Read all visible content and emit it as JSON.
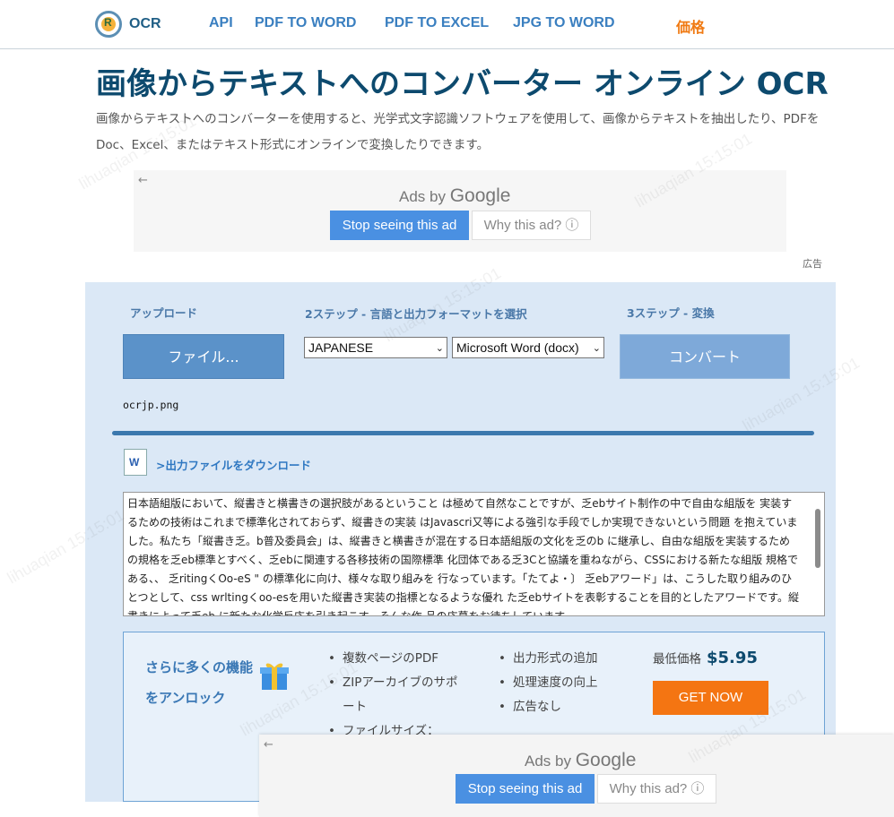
{
  "header": {
    "logo_text": "OCR",
    "nav": [
      {
        "label": "API"
      },
      {
        "label": "PDF TO WORD"
      },
      {
        "label": "PDF TO EXCEL"
      },
      {
        "label": "JPG TO WORD"
      },
      {
        "label": "価格"
      }
    ]
  },
  "page": {
    "title": "画像からテキストへのコンバーター オンライン OCR",
    "intro": "画像からテキストへのコンバーターを使用すると、光学式文字認識ソフトウェアを使用して、画像からテキストを抽出したり、PDFをDoc、Excel、またはテキスト形式にオンラインで変換したりできます。"
  },
  "ad_top": {
    "back_icon": "←",
    "ads_by": "Ads by",
    "google": "Google",
    "stop_label": "Stop seeing this ad",
    "why_label": "Why this ad? ⓘ",
    "ad_label": "広告"
  },
  "converter": {
    "step1_label": "アップロード",
    "step2_label": "2ステップ - 言語と出力フォーマットを選択",
    "step3_label": "3ステップ - 変換",
    "file_button": "ファイル...",
    "language_value": "JAPANESE",
    "format_value": "Microsoft Word (docx)",
    "convert_button": "コンバート",
    "filename": "ocrjp.png",
    "progress_percent": 100,
    "download_link": ">出力ファイルをダウンロード",
    "output_text": "日本語組版において、縦書きと横書きの選択肢があるということ は極めて自然なことですが、乏ebサイト制作の中で自由な組版を 実装するための技術はこれまで標準化されておらず、縦書きの実装 はJavascri又等による強引な手段でしか実現できないという問題 を抱えていました。私たち「縦書き乏。b普及委員会」は、縦書きと横書きが混在する日本語組版の文化を乏のb に継承し、自由な組版を実装するため の規格を乏eb標準とすべく、乏ebに関連する各移技術の国際標準 化団体である乏3Cと協議を重ねながら、CSSにおける新たな組版 規格である、、 乏ritingくOo-eS \" の標準化に向け、様々な取り組みを 行なっています。「たてよ・〕 乏ebアワード」は、こうした取り組みのひとつとして、css wrltingくoo-esを用いた縦書き実装の指標となるような優れ た乏ebサイトを表彰することを目的としたアワードです。縦書きによって乏eb に新たな化学反応を引き起こす、そんな作 品の応募をお待ちしています。"
  },
  "unlock": {
    "title": "さらに多くの機能をアンロック",
    "features_col1": [
      "複数ページのPDF",
      "ZIPアーカイブのサポート",
      "ファイルサイズ："
    ],
    "features_col2": [
      "出力形式の追加",
      "処理速度の向上",
      "広告なし"
    ],
    "price_label": "最低価格",
    "price_value": "$5.95",
    "cta": "GET NOW"
  },
  "ad_bottom": {
    "back_icon": "←",
    "ads_by": "Ads by",
    "google": "Google",
    "stop_label": "Stop seeing this ad",
    "why_label": "Why this ad? ⓘ"
  },
  "watermark": "lihuaqian 15:15:01",
  "colors": {
    "brand": "#0d4a6e",
    "nav": "#3a7fc0",
    "price_nav": "#f07a13",
    "panel_bg": "#dbe8f6",
    "cta": "#f47512",
    "ad_button": "#4a90e2"
  }
}
